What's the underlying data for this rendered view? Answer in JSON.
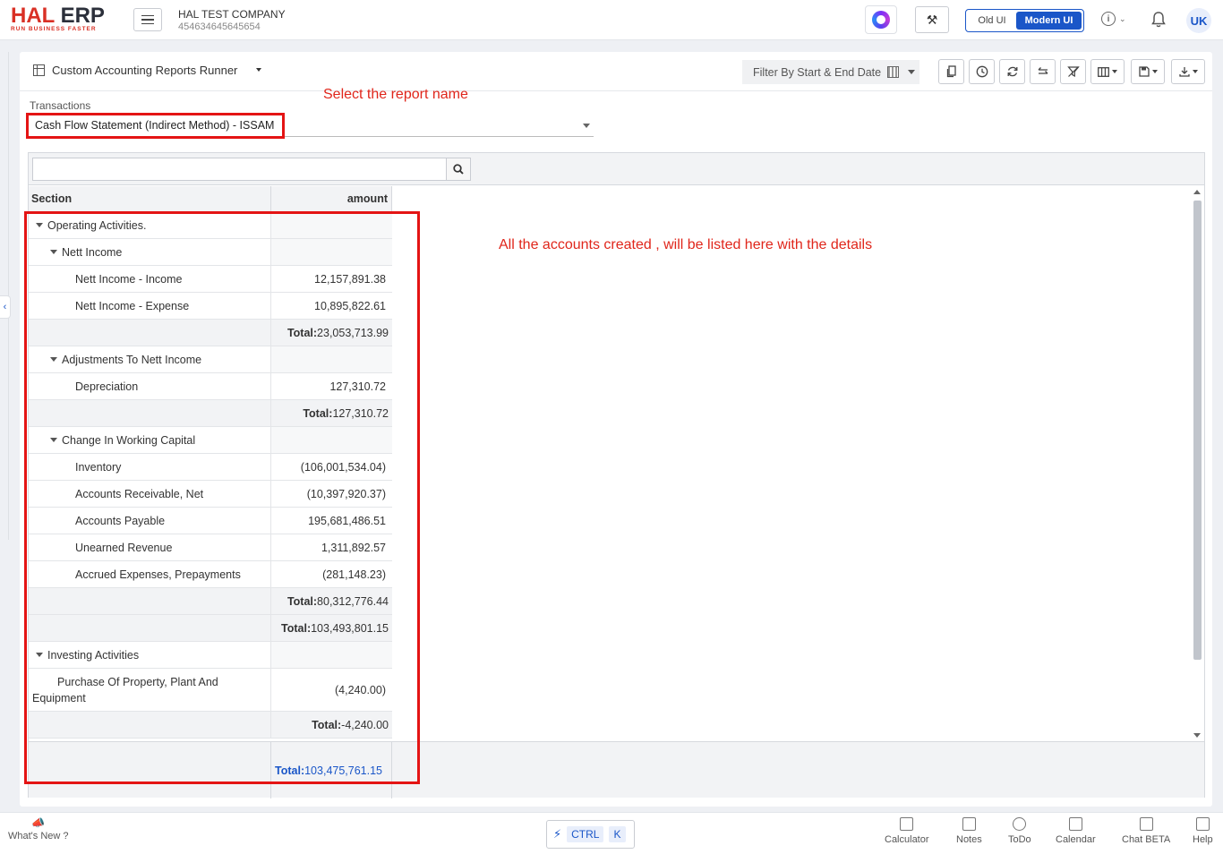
{
  "app": {
    "logo_main": "HAL",
    "logo_second": "ERP",
    "tagline": "RUN BUSINESS FASTER",
    "company_name": "HAL TEST COMPANY",
    "company_id": "454634645645654",
    "ui_old_label": "Old UI",
    "ui_modern_label": "Modern UI",
    "avatar_initials": "UK",
    "info_icon_text": "i",
    "accent_color": "#1a56c8",
    "brand_color": "#d93025"
  },
  "page": {
    "title": "Custom Accounting Reports Runner",
    "date_filter_label": "Filter By Start & End Date",
    "field_label": "Transactions",
    "selected_report": "Cash Flow Statement (Indirect Method) - ISSAM"
  },
  "annotations": {
    "select_report": "Select the report name",
    "accounts_listed": "All the accounts created , will be listed here with the details"
  },
  "grid": {
    "search_placeholder": "",
    "col_section": "Section",
    "col_amount": "amount",
    "grand_total_label": "Total:",
    "grand_total_value": "103,475,761.15",
    "rows": [
      {
        "type": "group",
        "level": 1,
        "section": "Operating Activities.",
        "amount": ""
      },
      {
        "type": "group",
        "level": 2,
        "section": "Nett Income",
        "amount": ""
      },
      {
        "type": "item",
        "level": 3,
        "section": "Nett Income - Income",
        "amount": "12,157,891.38"
      },
      {
        "type": "item",
        "level": 3,
        "section": "Nett Income - Expense",
        "amount": "10,895,822.61"
      },
      {
        "type": "subtotal",
        "section": "",
        "label": "Total:",
        "amount": "23,053,713.99"
      },
      {
        "type": "group",
        "level": 2,
        "section": "Adjustments To Nett Income",
        "amount": ""
      },
      {
        "type": "item",
        "level": 3,
        "section": "Depreciation",
        "amount": "127,310.72"
      },
      {
        "type": "subtotal",
        "section": "",
        "label": "Total:",
        "amount": "127,310.72"
      },
      {
        "type": "group",
        "level": 2,
        "section": "Change In Working Capital",
        "amount": ""
      },
      {
        "type": "item",
        "level": 3,
        "section": "Inventory",
        "amount": "(106,001,534.04)"
      },
      {
        "type": "item",
        "level": 3,
        "section": "Accounts Receivable, Net",
        "amount": "(10,397,920.37)"
      },
      {
        "type": "item",
        "level": 3,
        "section": "Accounts Payable",
        "amount": "195,681,486.51"
      },
      {
        "type": "item",
        "level": 3,
        "section": "Unearned Revenue",
        "amount": "1,311,892.57"
      },
      {
        "type": "item",
        "level": 3,
        "section": "Accrued Expenses, Prepayments",
        "amount": "(281,148.23)"
      },
      {
        "type": "subtotal",
        "section": "",
        "label": "Total:",
        "amount": "80,312,776.44"
      },
      {
        "type": "subtotal",
        "section": "",
        "label": "Total:",
        "amount": "103,493,801.15"
      },
      {
        "type": "group",
        "level": 1,
        "section": "Investing Activities",
        "amount": ""
      },
      {
        "type": "item_wrap",
        "level": 3,
        "section_line1": "Purchase Of Property, Plant And",
        "section_line2": "Equipment",
        "amount": "(4,240.00)"
      },
      {
        "type": "subtotal",
        "section": "",
        "label": "Total:",
        "amount": "-4,240.00"
      }
    ]
  },
  "bottom": {
    "whats_new": "What's New ?",
    "ctrl": "CTRL",
    "k": "K",
    "tools": [
      "Calculator",
      "Notes",
      "ToDo",
      "Calendar",
      "Chat BETA",
      "Help"
    ]
  }
}
